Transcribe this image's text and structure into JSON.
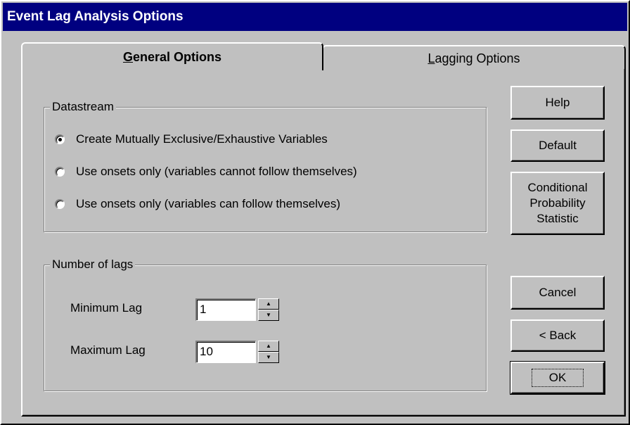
{
  "window": {
    "title": "Event Lag Analysis Options"
  },
  "tabs": [
    {
      "label": "General Options",
      "accel": "G",
      "active": true
    },
    {
      "label": "Lagging Options",
      "accel": "L",
      "active": false
    }
  ],
  "datastream": {
    "legend": "Datastream",
    "options": [
      {
        "label": "Create Mutually Exclusive/Exhaustive Variables",
        "selected": true
      },
      {
        "label": "Use onsets only (variables cannot follow themselves)",
        "selected": false
      },
      {
        "label": "Use onsets only (variables can follow themselves)",
        "selected": false
      }
    ]
  },
  "lags": {
    "legend": "Number of lags",
    "min_label": "Minimum Lag",
    "min_value": "1",
    "max_label": "Maximum Lag",
    "max_value": "10"
  },
  "buttons": {
    "help": "Help",
    "default": "Default",
    "conditional_line1": "Conditional",
    "conditional_line2": "Probability",
    "conditional_line3": "Statistic",
    "cancel": "Cancel",
    "back": "< Back",
    "ok": "OK"
  },
  "icons": {
    "spin_up": "up-arrow-icon",
    "spin_down": "down-arrow-icon"
  },
  "colors": {
    "titlebar": "#000080",
    "face": "#c0c0c0"
  }
}
